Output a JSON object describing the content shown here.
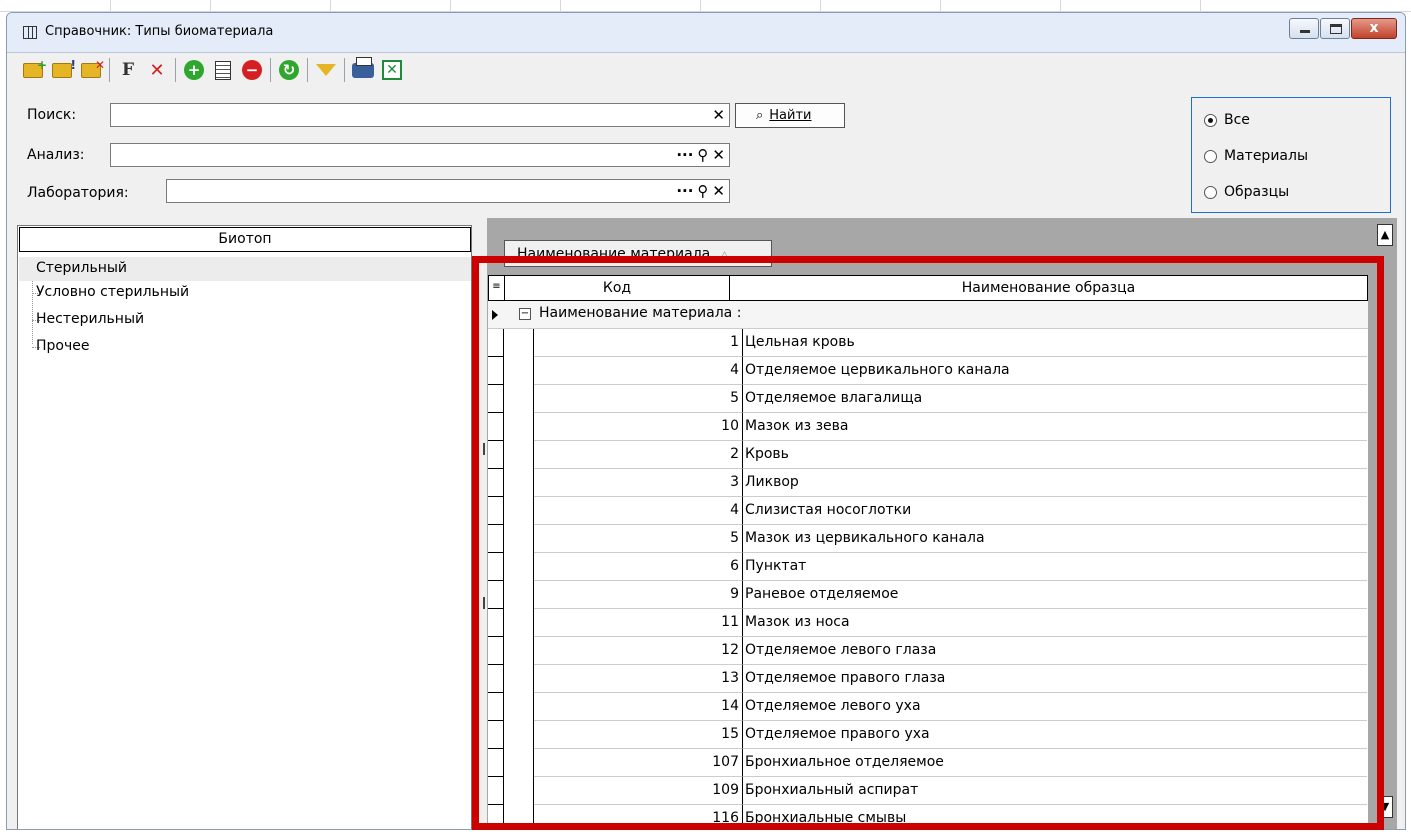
{
  "window": {
    "title": "Справочник: Типы биоматериала",
    "close_glyph": "x"
  },
  "toolbar": {
    "buttons": [
      "add-folder",
      "edit-folder",
      "delete-folder",
      "add-filter",
      "delete-filter",
      "add",
      "edit",
      "delete",
      "refresh",
      "filter",
      "print",
      "export-excel"
    ]
  },
  "search": {
    "search_label": "Поиск:",
    "search_value": "",
    "analysis_label": "Анализ:",
    "analysis_value": "",
    "lab_label": "Лаборатория:",
    "lab_value": "",
    "find_button": "Найти",
    "ellipsis": "···",
    "clear_glyph": "✕",
    "search_glyph": "⚲"
  },
  "filter": {
    "options": [
      "Все",
      "Материалы",
      "Образцы"
    ],
    "selected": "Все"
  },
  "biotope": {
    "header": "Биотоп",
    "items": [
      "Стерильный",
      "Условно стерильный",
      "Нестерильный",
      "Прочее"
    ]
  },
  "grid": {
    "group_by_chip": "Наименование материала",
    "sort_glyph": "△",
    "columns": {
      "code": "Код",
      "name": "Наименование образца"
    },
    "group_row": "Наименование материала :",
    "collapse_glyph": "−",
    "rows": [
      {
        "code": "1",
        "name": "Цельная кровь"
      },
      {
        "code": "4",
        "name": "Отделяемое цервикального канала"
      },
      {
        "code": "5",
        "name": "Отделяемое влагалища"
      },
      {
        "code": "10",
        "name": "Мазок из зева"
      },
      {
        "code": "2",
        "name": "Кровь"
      },
      {
        "code": "3",
        "name": "Ликвор"
      },
      {
        "code": "4",
        "name": "Слизистая носоглотки"
      },
      {
        "code": "5",
        "name": "Мазок из цервикального канала"
      },
      {
        "code": "6",
        "name": "Пунктат"
      },
      {
        "code": "9",
        "name": "Раневое отделяемое"
      },
      {
        "code": "11",
        "name": "Мазок из носа"
      },
      {
        "code": "12",
        "name": "Отделяемое левого глаза"
      },
      {
        "code": "13",
        "name": "Отделяемое правого глаза"
      },
      {
        "code": "14",
        "name": "Отделяемое левого уха"
      },
      {
        "code": "15",
        "name": "Отделяемое правого уха"
      },
      {
        "code": "107",
        "name": "Бронхиальное отделяемое"
      },
      {
        "code": "109",
        "name": "Бронхиальный аспират"
      },
      {
        "code": "116",
        "name": "Бронхиальные смывы"
      }
    ]
  },
  "colors": {
    "highlight": "#cc0000",
    "radio_border": "#1e6fd0",
    "close_button": "#c2422a"
  }
}
